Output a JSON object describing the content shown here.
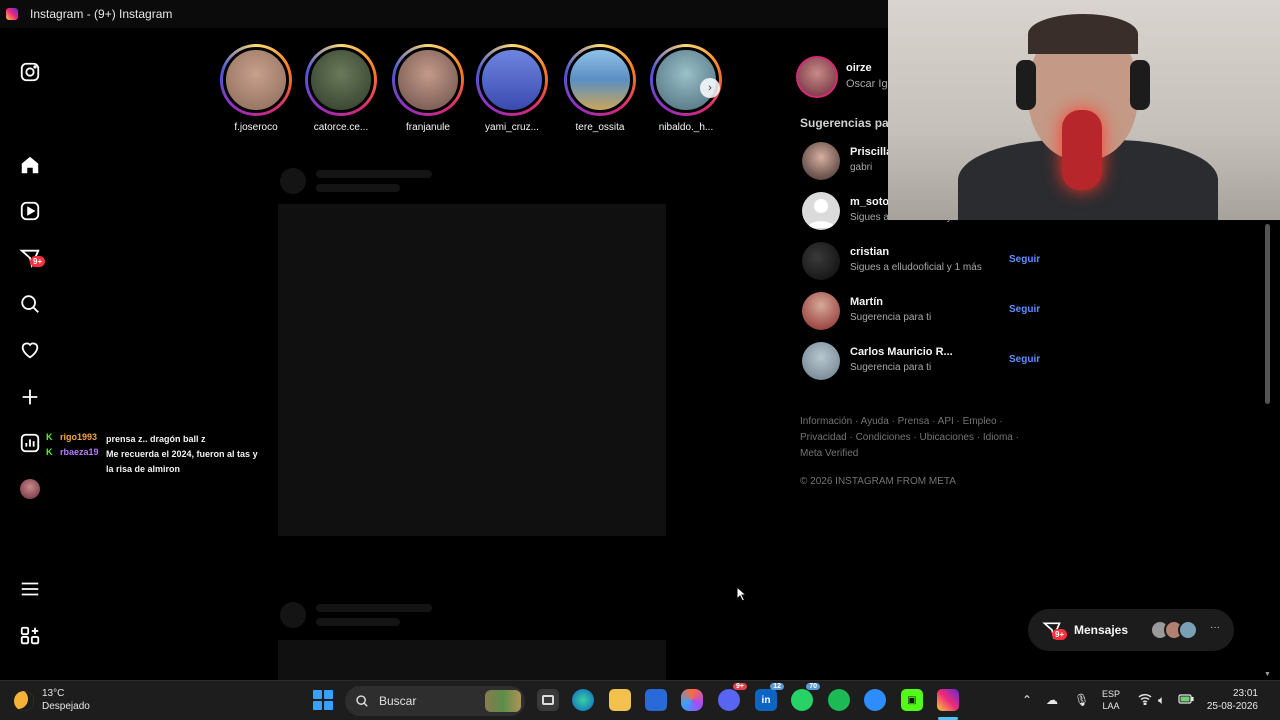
{
  "window": {
    "title": "Instagram - (9+) Instagram"
  },
  "nav": {
    "notifications_badge": "9+"
  },
  "stories": [
    {
      "username": "f.joseroco",
      "color": "#8a6a58"
    },
    {
      "username": "catorce.ce...",
      "color": "#2f3a2a"
    },
    {
      "username": "franjanule",
      "color": "#6a4f48"
    },
    {
      "username": "yami_cruz...",
      "color": "#3b4ab0"
    },
    {
      "username": "tere_ossita",
      "color": "#5b8fc2"
    },
    {
      "username": "nibaldo._h...",
      "color": "#4a6b7a"
    }
  ],
  "chat": [
    {
      "user": "rigo1993",
      "user_color": "#f0a840",
      "text": "prensa z.. dragón ball z"
    },
    {
      "user": "rbaeza19",
      "user_color": "#b57bff",
      "text": "Me recuerda el 2024, fueron al tas y la risa de almiron"
    }
  ],
  "profile": {
    "username": "oirze",
    "fullname": "Oscar Ig"
  },
  "suggestions": {
    "header": "Sugerencias para",
    "items": [
      {
        "name": "Priscilla",
        "sub": "gabri",
        "follow": "",
        "avatar_color": "#3a2a2a"
      },
      {
        "name": "m_soto",
        "sub": "Sigues a elludooficial y 2 más",
        "follow": "",
        "avatar_color": "#dbdbdb"
      },
      {
        "name": "cristian",
        "sub": "Sigues a elludooficial y 1 más",
        "follow": "Seguir",
        "avatar_color": "#151515"
      },
      {
        "name": "Martín",
        "sub": "Sugerencia para ti",
        "follow": "Seguir",
        "avatar_color": "#8a2a2a"
      },
      {
        "name": "Carlos Mauricio R...",
        "sub": "Sugerencia para ti",
        "follow": "Seguir",
        "avatar_color": "#6a7a8a"
      }
    ]
  },
  "footer": {
    "links_line1": "Información · Ayuda · Prensa · API · Empleo ·",
    "links_line2": "Privacidad · Condiciones · Ubicaciones · Idioma ·",
    "links_line3": "Meta Verified",
    "copyright": "© 2026 INSTAGRAM FROM META"
  },
  "messages": {
    "label": "Mensajes",
    "badge": "9+",
    "more": "···"
  },
  "taskbar": {
    "weather_temp": "13°C",
    "weather_desc": "Despejado",
    "search_placeholder": "Buscar",
    "discord_badge": "9+",
    "linkedin_badge": "12",
    "whatsapp_badge": "70",
    "lang_line1": "ESP",
    "lang_line2": "LAA",
    "time": "23:01",
    "date": "25-08-2026"
  }
}
